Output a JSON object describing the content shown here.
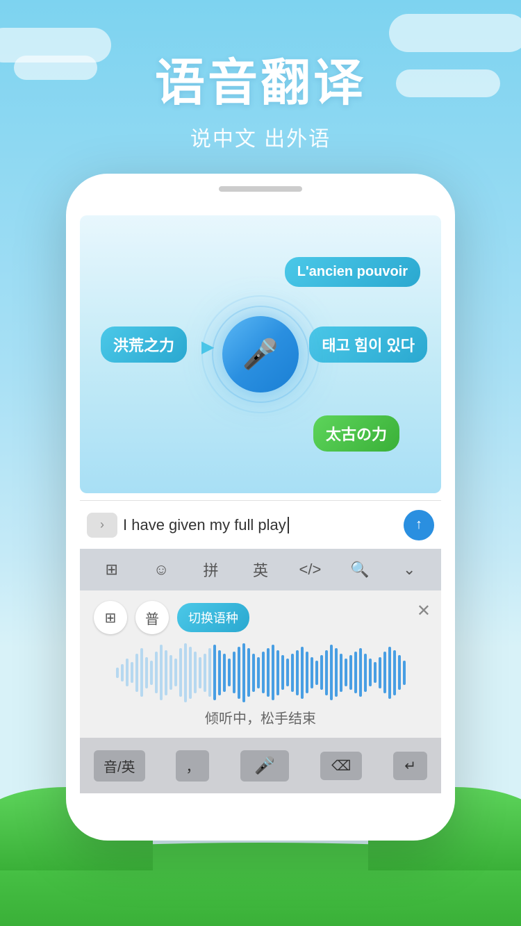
{
  "page": {
    "title": "语音翻译",
    "subtitle": "说中文 出外语"
  },
  "bubbles": {
    "chinese": "洪荒之力",
    "french": "L'ancien pouvoir",
    "korean": "태고 힘이 있다",
    "japanese": "太古の力"
  },
  "input": {
    "text": "I have given my full play",
    "arrow_label": "›",
    "send_label": "↑"
  },
  "keyboard_toolbar": {
    "items": [
      "⊞",
      "☺",
      "拼",
      "英",
      "</>",
      "🔍",
      "⌄"
    ]
  },
  "voice_panel": {
    "btn1_label": "⊞",
    "btn2_label": "普",
    "switch_label": "切换语种",
    "close_label": "✕",
    "hint": "倾听中，松手结束"
  },
  "bottom_keyboard": {
    "key1": "音/英",
    "key2": "，",
    "mic_label": "🎤",
    "delete_label": "⌫",
    "enter_label": "↵"
  },
  "waveform": {
    "bars": [
      15,
      25,
      40,
      30,
      55,
      70,
      45,
      35,
      60,
      80,
      65,
      50,
      40,
      70,
      85,
      75,
      60,
      45,
      55,
      70,
      80,
      65,
      55,
      40,
      60,
      75,
      85,
      70,
      55,
      45,
      60,
      70,
      80,
      65,
      50,
      40,
      55,
      65,
      75,
      60,
      45,
      35,
      50,
      65,
      80,
      70,
      55,
      40,
      50,
      60,
      70,
      55,
      40,
      30,
      45,
      60,
      75,
      65,
      50,
      35
    ]
  }
}
